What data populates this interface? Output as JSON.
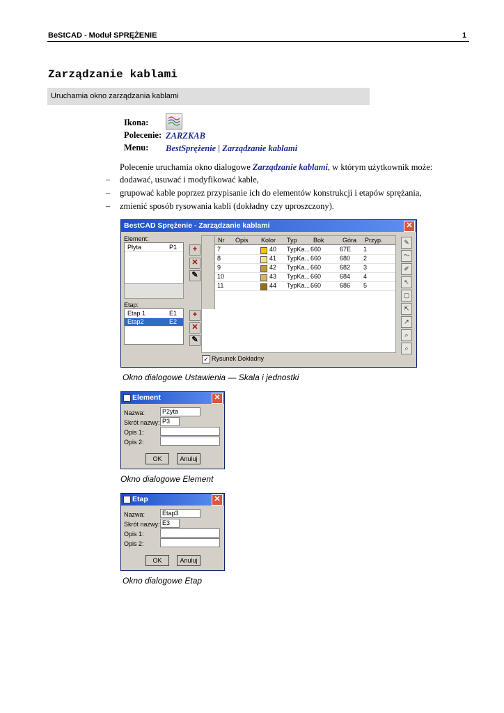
{
  "header": {
    "left": "BeStCAD - Moduł SPRĘŻENIE",
    "page": "1"
  },
  "title": "Zarządzanie kablami",
  "subtitle": "Uruchamia okno zarządzania kablami",
  "info": {
    "ikona_label": "Ikona:",
    "polecenie_label": "Polecenie:",
    "polecenie_value": "ZARZKAB",
    "menu_label": "Menu:",
    "menu_value": "BestSprężenie | Zarządzanie kablami"
  },
  "intro": {
    "before": "Polecenie uruchamia okno dialogowe ",
    "link": "Zarządzanie kablami",
    "after": ", w którym użytkownik może:"
  },
  "bullets": [
    "dodawać, usuwać i modyfikować kable,",
    "grupować kable poprzez przypisanie ich do elementów konstrukcji i etapów sprężania,",
    "zmienić sposób rysowania kabli (dokładny czy uproszczony)."
  ],
  "main_dialog": {
    "title": "BestCAD Sprężenie - Zarządzanie kablami",
    "element_label": "Element:",
    "elements": [
      {
        "name": "Płyta",
        "short": "P1"
      }
    ],
    "etap_label": "Etap:",
    "etaps": [
      {
        "name": "Etap 1",
        "short": "E1"
      },
      {
        "name": "Etap2",
        "short": "E2"
      }
    ],
    "columns": [
      "Nr",
      "Opis",
      "Kolor",
      "Typ",
      "Bok",
      "Góra",
      "Przyp."
    ],
    "rows": [
      {
        "nr": "7",
        "opis": "",
        "kolor": "40",
        "color": "#f5c400",
        "typ": "TypKa...",
        "bok": "660",
        "gora": "67E",
        "przyp": "1"
      },
      {
        "nr": "8",
        "opis": "",
        "kolor": "41",
        "color": "#f6e28a",
        "typ": "TypKa...",
        "bok": "660",
        "gora": "680",
        "przyp": "2"
      },
      {
        "nr": "9",
        "opis": "",
        "kolor": "42",
        "color": "#c49a22",
        "typ": "TypKa...",
        "bok": "660",
        "gora": "682",
        "przyp": "3"
      },
      {
        "nr": "10",
        "opis": "",
        "kolor": "43",
        "color": "#d8b366",
        "typ": "TypKa...",
        "bok": "660",
        "gora": "684",
        "przyp": "4"
      },
      {
        "nr": "11",
        "opis": "",
        "kolor": "44",
        "color": "#9a6e16",
        "typ": "TypKa...",
        "bok": "660",
        "gora": "686",
        "przyp": "5"
      }
    ],
    "checkbox_label": "Rysunek Dokładny",
    "checkbox_checked": true
  },
  "caption1": "Okno dialogowe Ustawienia — Skala i jednostki",
  "element_dialog": {
    "title": "Element",
    "labels": [
      "Nazwa:",
      "Skrót nazwy:",
      "Opis 1:",
      "Opis 2:"
    ],
    "values": [
      "P2yta",
      "P3",
      "",
      ""
    ],
    "ok": "OK",
    "cancel": "Anuluj"
  },
  "caption2": "Okno dialogowe Element",
  "etap_dialog": {
    "title": "Etap",
    "labels": [
      "Nazwa:",
      "Skrót nazwy:",
      "Opis 1:",
      "Opis 2:"
    ],
    "values": [
      "Etap3",
      "E3",
      "",
      ""
    ],
    "ok": "OK",
    "cancel": "Anuluj"
  },
  "caption3": "Okno dialogowe Etap"
}
